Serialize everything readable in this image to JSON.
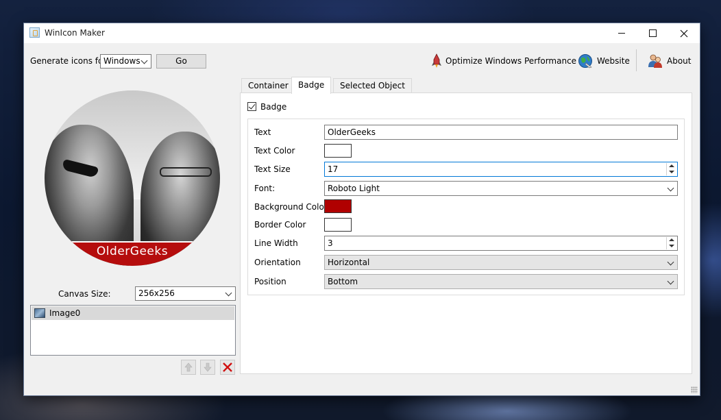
{
  "window": {
    "title": "WinIcon Maker"
  },
  "toolbar": {
    "generate_label": "Generate icons for",
    "platform_value": "Windows",
    "go_label": "Go",
    "optimize_label": "Optimize Windows Performance",
    "website_label": "Website",
    "about_label": "About"
  },
  "preview": {
    "badge_text": "OlderGeeks"
  },
  "canvas": {
    "label": "Canvas Size:",
    "value": "256x256"
  },
  "layers": {
    "items": [
      {
        "label": "Image0"
      }
    ]
  },
  "tabs": [
    {
      "label": "Container"
    },
    {
      "label": "Badge"
    },
    {
      "label": "Selected Object"
    }
  ],
  "badge": {
    "checkbox_label": "Badge",
    "checked": true,
    "text_label": "Text",
    "text_value": "OlderGeeks",
    "text_color_label": "Text Color",
    "text_color": "#ffffff",
    "text_size_label": "Text Size",
    "text_size_value": "17",
    "font_label": "Font:",
    "font_value": "Roboto Light",
    "bg_color_label": "Background Color",
    "bg_color": "#b00000",
    "border_color_label": "Border Color",
    "border_color": "#ffffff",
    "line_width_label": "Line Width",
    "line_width_value": "3",
    "orientation_label": "Orientation",
    "orientation_value": "Horizontal",
    "position_label": "Position",
    "position_value": "Bottom"
  }
}
